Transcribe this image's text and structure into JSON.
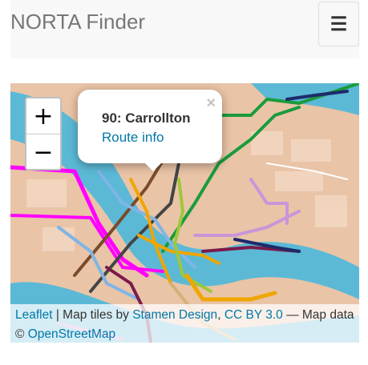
{
  "navbar": {
    "brand": "NORTA Finder",
    "toggle_icon": "hamburger-icon",
    "toggle_glyph": "☰"
  },
  "map": {
    "zoom_in_label": "+",
    "zoom_out_label": "−",
    "popup": {
      "title": "90: Carrollton",
      "link": "Route info",
      "close_label": "×"
    },
    "attribution": {
      "leaflet": "Leaflet",
      "sep1": " | Map tiles by ",
      "stamen": "Stamen Design",
      "comma": ", ",
      "license": "CC BY 3.0",
      "sep2": " — Map data © ",
      "osm": "OpenStreetMap"
    },
    "colors": {
      "land": "#e9c4a7",
      "water": "#5bb9d6",
      "link": "#0078a8"
    }
  }
}
